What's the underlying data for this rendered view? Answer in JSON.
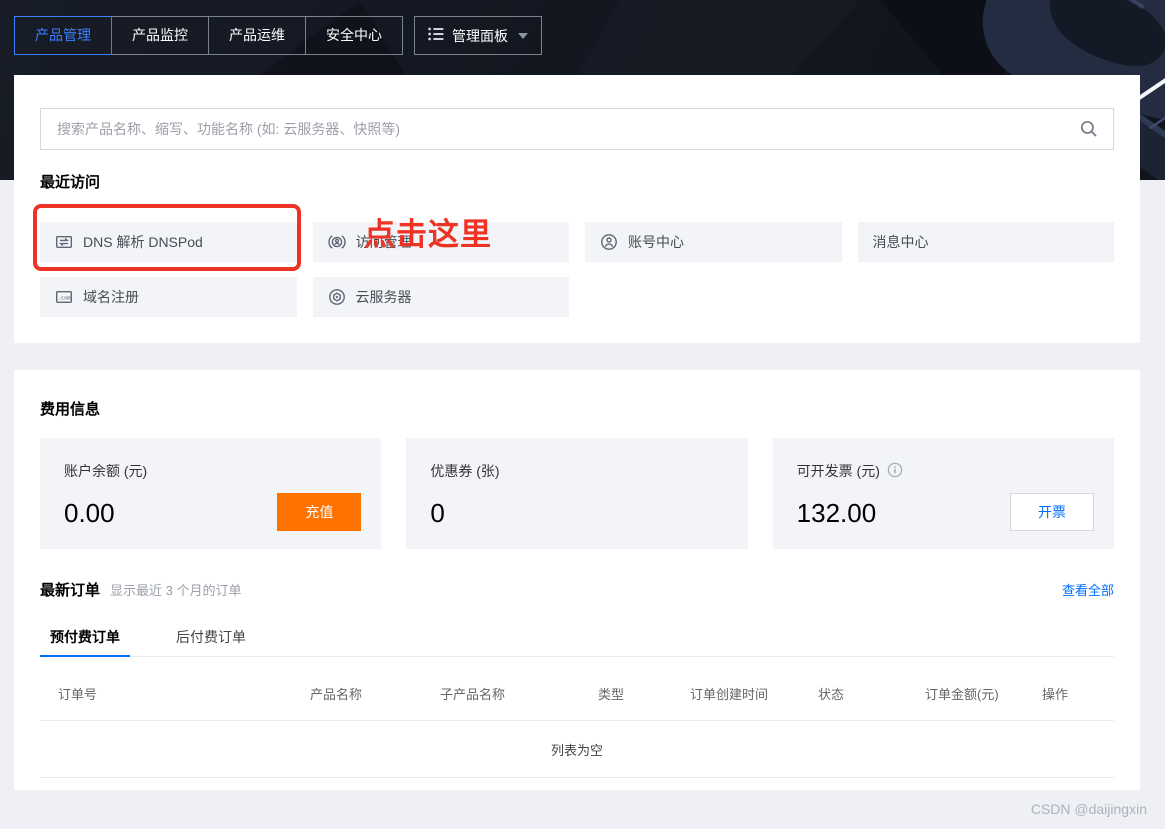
{
  "nav": {
    "tabs": [
      {
        "label": "产品管理",
        "active": true
      },
      {
        "label": "产品监控",
        "active": false
      },
      {
        "label": "产品运维",
        "active": false
      },
      {
        "label": "安全中心",
        "active": false
      }
    ],
    "panel_button_label": "管理面板"
  },
  "search": {
    "placeholder": "搜索产品名称、缩写、功能名称 (如: 云服务器、快照等)"
  },
  "recent": {
    "title": "最近访问",
    "annotation": "点击这里",
    "items": [
      {
        "label": "DNS 解析 DNSPod",
        "icon": "dns-icon",
        "highlighted": true
      },
      {
        "label": "访问管理",
        "icon": "cam-icon"
      },
      {
        "label": "账号中心",
        "icon": "account-icon"
      },
      {
        "label": "消息中心",
        "icon": "none"
      },
      {
        "label": "域名注册",
        "icon": "domain-icon"
      },
      {
        "label": "云服务器",
        "icon": "cvm-icon"
      }
    ]
  },
  "billing": {
    "title": "费用信息",
    "cards": [
      {
        "label": "账户余额 (元)",
        "value": "0.00",
        "button": "充值"
      },
      {
        "label": "优惠券 (张)",
        "value": "0"
      },
      {
        "label": "可开发票 (元)",
        "value": "132.00",
        "button": "开票",
        "has_info_icon": true
      }
    ]
  },
  "orders": {
    "title": "最新订单",
    "subtitle": "显示最近 3 个月的订单",
    "view_all": "查看全部",
    "tabs": [
      {
        "label": "预付费订单",
        "active": true
      },
      {
        "label": "后付费订单",
        "active": false
      }
    ],
    "columns": [
      "订单号",
      "产品名称",
      "子产品名称",
      "类型",
      "订单创建时间",
      "状态",
      "订单金额(元)",
      "操作"
    ],
    "empty_text": "列表为空"
  },
  "watermark": "CSDN @daijingxin",
  "colors": {
    "accent_blue": "#006eff",
    "active_tab_blue": "#3d7fff",
    "recharge_orange": "#ff7200",
    "annotation_red": "#ee3224",
    "banner_dark": "#12161f",
    "card_bg": "#f2f4f8"
  }
}
